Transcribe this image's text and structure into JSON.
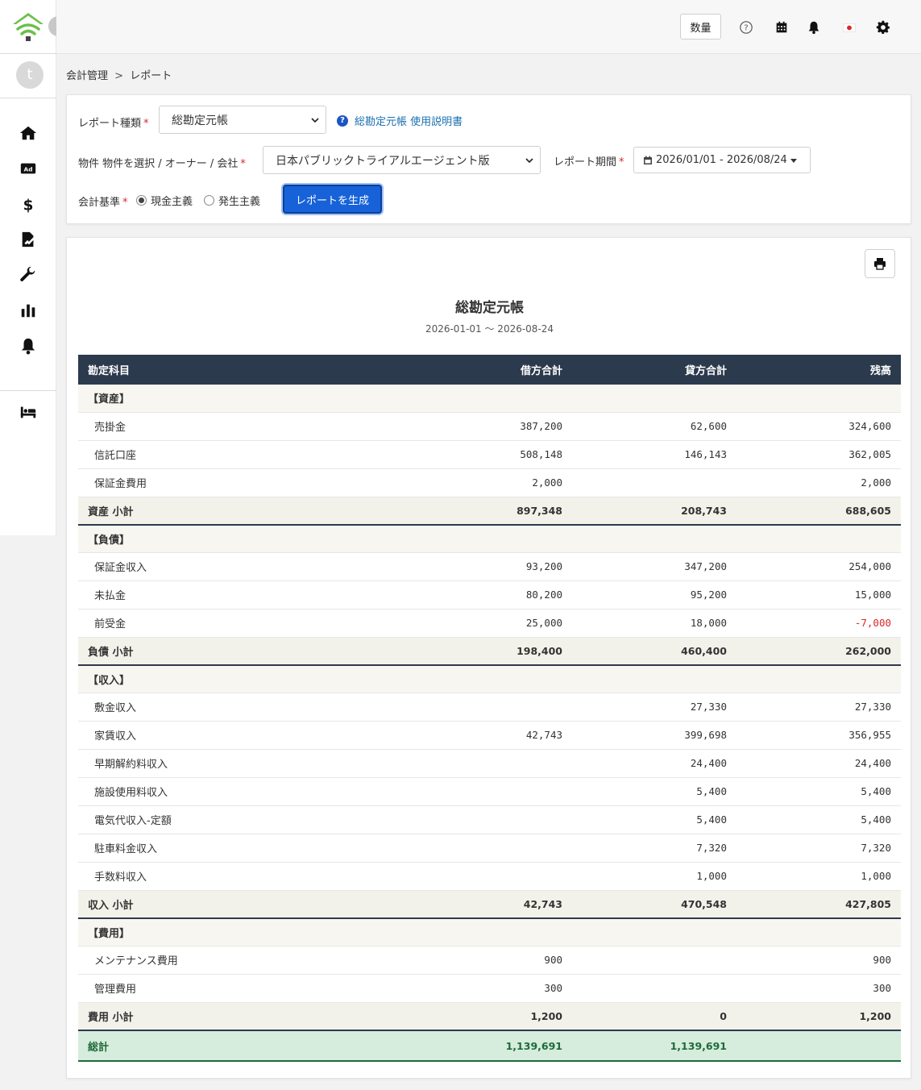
{
  "topbar": {
    "quantity_label": "数量"
  },
  "sidebar": {
    "avatar_letter": "t"
  },
  "breadcrumb": {
    "parent": "会計管理",
    "separator": ">",
    "current": "レポート"
  },
  "filters": {
    "report_type_label": "レポート種類",
    "report_type_value": "総勘定元帳",
    "help_link_label": "総勘定元帳 使用説明書",
    "property_label": "物件 物件を選択 / オーナー / 会社",
    "property_value": "日本パブリックトライアルエージェント版",
    "period_label": "レポート期間",
    "period_value": "2026/01/01 - 2026/08/24",
    "basis_label": "会計基準",
    "basis_cash": "現金主義",
    "basis_accrual": "発生主義",
    "generate_button": "レポートを生成"
  },
  "report": {
    "title": "総勘定元帳",
    "period": "2026-01-01 〜 2026-08-24",
    "columns": [
      "勘定科目",
      "借方合計",
      "貸方合計",
      "残高"
    ],
    "sections": [
      {
        "heading": "【資産】",
        "items": [
          {
            "name": "売掛金",
            "debit": "387,200",
            "credit": "62,600",
            "balance": "324,600"
          },
          {
            "name": "信託口座",
            "debit": "508,148",
            "credit": "146,143",
            "balance": "362,005"
          },
          {
            "name": "保証金費用",
            "debit": "2,000",
            "credit": "",
            "balance": "2,000"
          }
        ],
        "subtotal": {
          "name": "資産 小計",
          "debit": "897,348",
          "credit": "208,743",
          "balance": "688,605"
        }
      },
      {
        "heading": "【負債】",
        "items": [
          {
            "name": "保証金収入",
            "debit": "93,200",
            "credit": "347,200",
            "balance": "254,000"
          },
          {
            "name": "未払金",
            "debit": "80,200",
            "credit": "95,200",
            "balance": "15,000"
          },
          {
            "name": "前受金",
            "debit": "25,000",
            "credit": "18,000",
            "balance": "-7,000"
          }
        ],
        "subtotal": {
          "name": "負債 小計",
          "debit": "198,400",
          "credit": "460,400",
          "balance": "262,000"
        }
      },
      {
        "heading": "【収入】",
        "items": [
          {
            "name": "敷金収入",
            "debit": "",
            "credit": "27,330",
            "balance": "27,330"
          },
          {
            "name": "家賃収入",
            "debit": "42,743",
            "credit": "399,698",
            "balance": "356,955"
          },
          {
            "name": "早期解約料収入",
            "debit": "",
            "credit": "24,400",
            "balance": "24,400"
          },
          {
            "name": "施設使用料収入",
            "debit": "",
            "credit": "5,400",
            "balance": "5,400"
          },
          {
            "name": "電気代収入-定額",
            "debit": "",
            "credit": "5,400",
            "balance": "5,400"
          },
          {
            "name": "駐車料金収入",
            "debit": "",
            "credit": "7,320",
            "balance": "7,320"
          },
          {
            "name": "手数料収入",
            "debit": "",
            "credit": "1,000",
            "balance": "1,000"
          }
        ],
        "subtotal": {
          "name": "収入 小計",
          "debit": "42,743",
          "credit": "470,548",
          "balance": "427,805"
        }
      },
      {
        "heading": "【費用】",
        "items": [
          {
            "name": "メンテナンス費用",
            "debit": "900",
            "credit": "",
            "balance": "900"
          },
          {
            "name": "管理費用",
            "debit": "300",
            "credit": "",
            "balance": "300"
          }
        ],
        "subtotal": {
          "name": "費用 小計",
          "debit": "1,200",
          "credit": "0",
          "balance": "1,200"
        }
      }
    ],
    "total": {
      "name": "総計",
      "debit": "1,139,691",
      "credit": "1,139,691",
      "balance": ""
    }
  },
  "colors": {
    "primary": "#1762d8",
    "table_header": "#2c3a4d",
    "total_bg": "#d6ecdc",
    "total_text": "#1e6b3a",
    "negative": "#d9272d",
    "logo_green": "#6cc04a"
  }
}
